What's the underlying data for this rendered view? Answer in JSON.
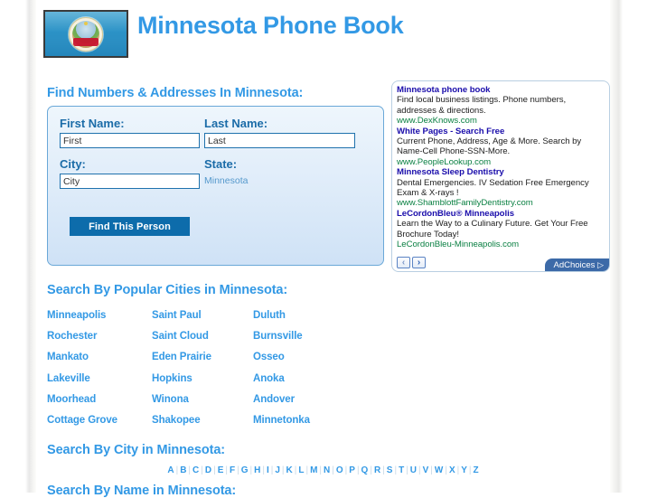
{
  "site": {
    "title": "Minnesota Phone Book",
    "flag_alt": "minnesota-state-flag",
    "accent_color": "#3399e5",
    "link_color": "#3399e5",
    "button_color": "#0d6cab"
  },
  "sections": {
    "find_heading": "Find Numbers & Addresses In Minnesota:",
    "popular_cities_heading": "Search By Popular Cities in Minnesota:",
    "search_by_city_heading": "Search By City in Minnesota:",
    "search_by_name_heading": "Search By Name in Minnesota:"
  },
  "form": {
    "first_name_label": "First Name:",
    "last_name_label": "Last Name:",
    "city_label": "City:",
    "state_label": "State:",
    "first_name_placeholder": "First",
    "last_name_placeholder": "Last",
    "city_placeholder": "City",
    "first_name_value": "",
    "last_name_value": "",
    "city_value": "",
    "state_value": "Minnesota",
    "submit_label": "Find This Person"
  },
  "ads": {
    "items": [
      {
        "title": "Minnesota phone book",
        "desc": "Find local business listings. Phone numbers, addresses & directions.",
        "url": "www.DexKnows.com"
      },
      {
        "title": "White Pages - Search Free",
        "desc": "Current Phone, Address, Age & More. Search by Name-Cell Phone-SSN-More.",
        "url": "www.PeopleLookup.com"
      },
      {
        "title": "Minnesota Sleep Dentistry",
        "desc": "Dental Emergencies. IV Sedation Free Emergency Exam & X-rays !",
        "url": "www.ShamblottFamilyDentistry.com"
      },
      {
        "title": "LeCordonBleu® Minneapolis",
        "desc": "Learn the Way to a Culinary Future. Get Your Free Brochure Today!",
        "url": "LeCordonBleu-Minneapolis.com"
      }
    ],
    "prev_label": "‹",
    "next_label": "›",
    "adchoices_label": "AdChoices",
    "adchoices_glyph": "▷"
  },
  "popular_cities": [
    [
      "Minneapolis",
      "Saint Paul",
      "Duluth"
    ],
    [
      "Rochester",
      "Saint Cloud",
      "Burnsville"
    ],
    [
      "Mankato",
      "Eden Prairie",
      "Osseo"
    ],
    [
      "Lakeville",
      "Hopkins",
      "Anoka"
    ],
    [
      "Moorhead",
      "Winona",
      "Andover"
    ],
    [
      "Cottage Grove",
      "Shakopee",
      "Minnetonka"
    ]
  ],
  "alphabet": [
    "A",
    "B",
    "C",
    "D",
    "E",
    "F",
    "G",
    "H",
    "I",
    "J",
    "K",
    "L",
    "M",
    "N",
    "O",
    "P",
    "Q",
    "R",
    "S",
    "T",
    "U",
    "V",
    "W",
    "X",
    "Y",
    "Z"
  ],
  "alphabet_separator": "|"
}
